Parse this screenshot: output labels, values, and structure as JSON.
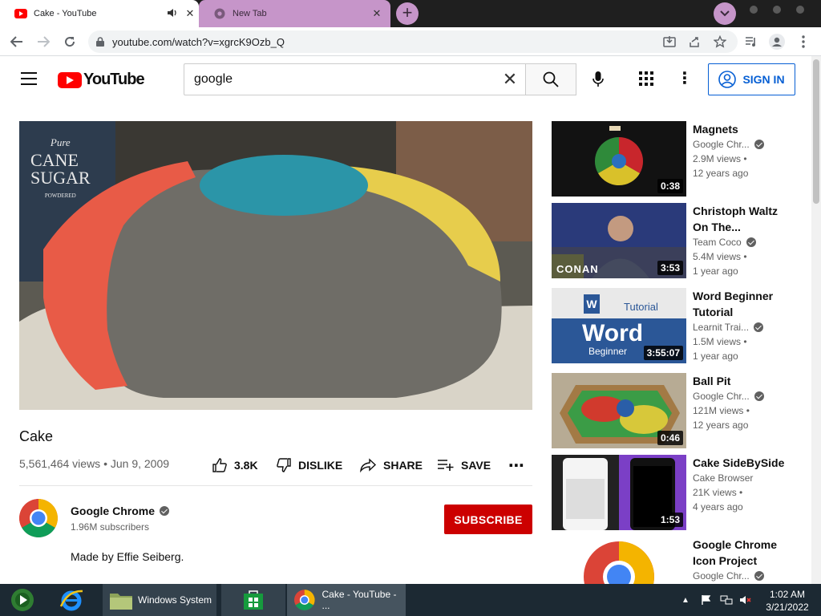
{
  "browser": {
    "tabs": [
      {
        "title": "Cake - YouTube",
        "active": true
      },
      {
        "title": "New Tab",
        "active": false
      }
    ],
    "url": "youtube.com/watch?v=xgrcK9Ozb_Q"
  },
  "youtube": {
    "logo_text": "YouTube",
    "search": {
      "value": "google"
    },
    "sign_in_label": "SIGN IN"
  },
  "video": {
    "title": "Cake",
    "stats": "5,561,464 views • Jun 9, 2009",
    "actions": {
      "like": "3.8K",
      "dislike": "DISLIKE",
      "share": "SHARE",
      "save": "SAVE"
    },
    "player_text": {
      "line1": "Pure",
      "line2": "CANE",
      "line3": "SUGAR",
      "line4": "POWDERED"
    },
    "channel": {
      "name": "Google Chrome",
      "subscribers": "1.96M subscribers"
    },
    "subscribe_label": "SUBSCRIBE",
    "description": "Made by Effie Seiberg."
  },
  "recommendations": [
    {
      "title": "Magnets",
      "channel": "Google Chr...",
      "views": "2.9M views •",
      "age": "12 years ago",
      "duration": "0:38"
    },
    {
      "title": "Christoph Waltz On The...",
      "channel": "Team Coco",
      "views": "5.4M views •",
      "age": "1 year ago",
      "duration": "3:53",
      "thumb_text": "CONAN"
    },
    {
      "title": "Word Beginner Tutorial",
      "channel": "Learnit Trai...",
      "views": "1.5M views •",
      "age": "1 year ago",
      "duration": "3:55:07",
      "thumb_text": {
        "tag": "Tutorial",
        "big": "Word",
        "sub": "Beginner",
        "w": "W"
      }
    },
    {
      "title": "Ball Pit",
      "channel": "Google Chr...",
      "views": "121M views •",
      "age": "12 years ago",
      "duration": "0:46"
    },
    {
      "title": "Cake SideBySide",
      "channel": "Cake Browser",
      "views": "21K views •",
      "age": "4 years ago",
      "duration": "1:53"
    },
    {
      "title": "Google Chrome Icon Project",
      "channel": "Google Chr..."
    }
  ],
  "taskbar": {
    "items": [
      "Windows System",
      "Cake - YouTube - ..."
    ],
    "time": "1:02 AM",
    "date": "3/21/2022"
  },
  "colors": {
    "brand_red": "#ff0000",
    "subscribe_red": "#cc0000",
    "link_blue": "#065fd4",
    "tab_accent": "#c695c9",
    "taskbar": "#1c2933"
  }
}
